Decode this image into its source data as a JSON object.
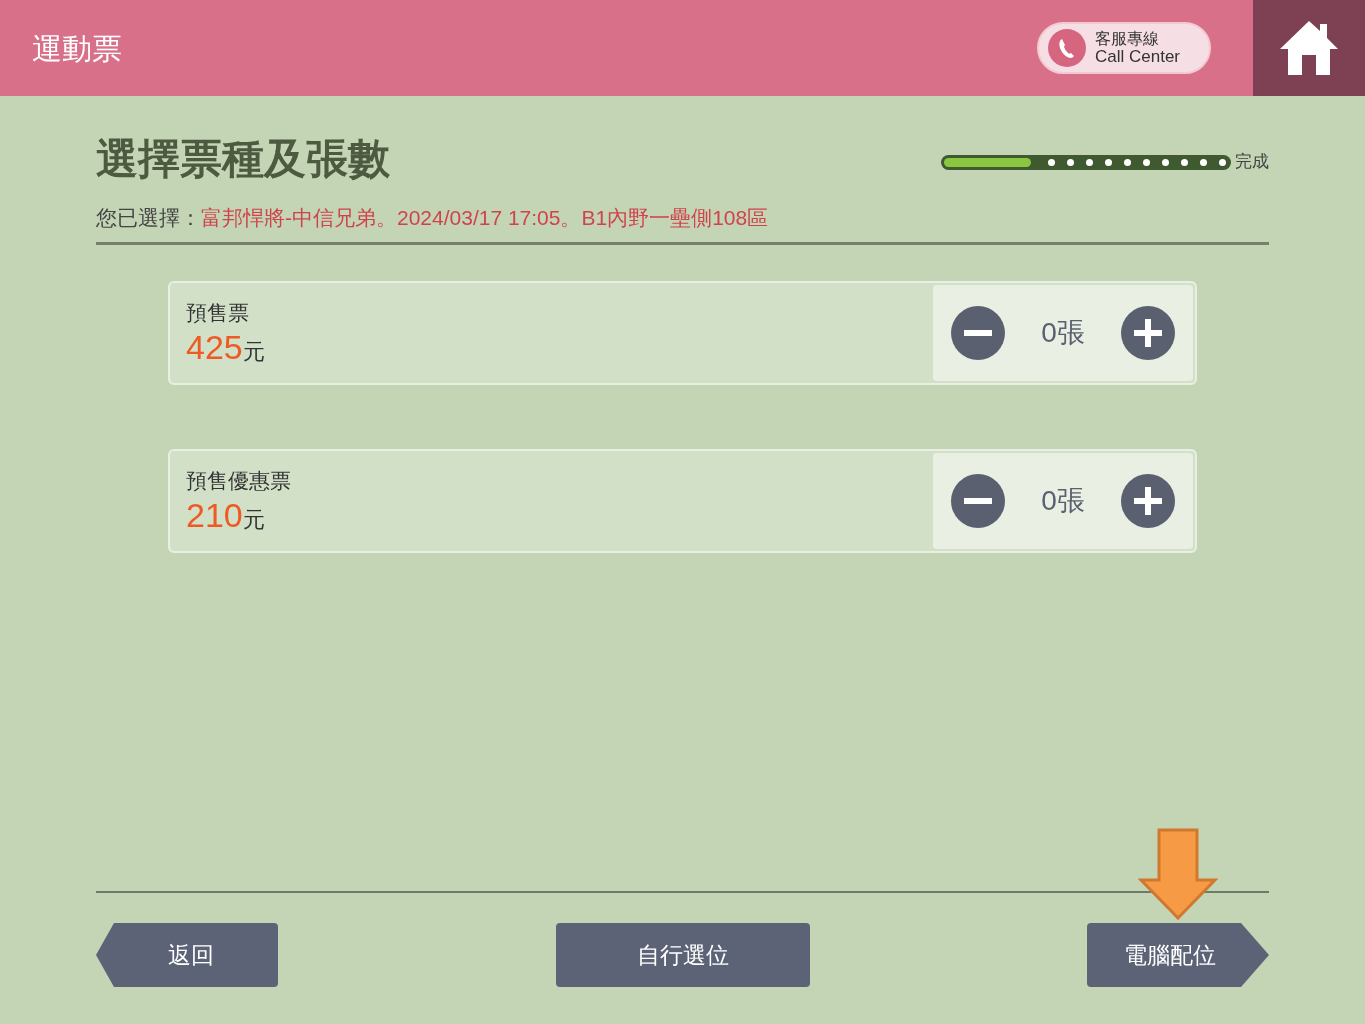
{
  "header": {
    "title": "運動票",
    "call_center": {
      "label_zh": "客服專線",
      "label_en": "Call Center"
    }
  },
  "page_title": "選擇票種及張數",
  "progress": {
    "level": 0.3,
    "label": "完成"
  },
  "selection": {
    "prefix": "您已選擇：",
    "detail": "富邦悍將-中信兄弟。2024/03/17 17:05。B1內野一壘側108區"
  },
  "tickets": [
    {
      "name": "預售票",
      "price": "425",
      "unit": "元",
      "count": "0張"
    },
    {
      "name": "預售優惠票",
      "price": "210",
      "unit": "元",
      "count": "0張"
    }
  ],
  "buttons": [
    {
      "label": "返回",
      "kind": "back",
      "highlighted": false
    },
    {
      "label": "自行選位",
      "kind": "plain",
      "highlighted": false
    },
    {
      "label": "電腦配位",
      "kind": "next",
      "highlighted": true
    }
  ]
}
